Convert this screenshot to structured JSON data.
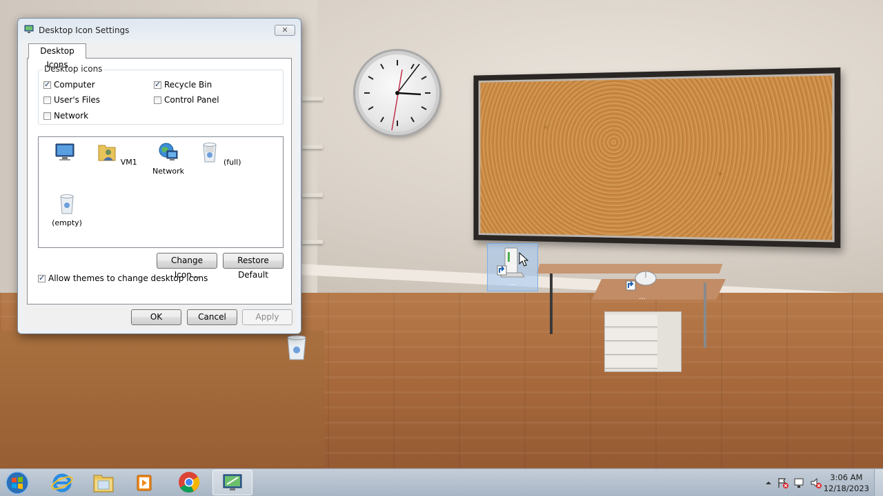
{
  "dialog": {
    "title": "Desktop Icon Settings",
    "close_glyph": "✕",
    "tab_label": "Desktop Icons",
    "group_label": "Desktop icons",
    "checkboxes": [
      {
        "label": "Computer",
        "checked": true
      },
      {
        "label": "Recycle Bin",
        "checked": true
      },
      {
        "label": "User's Files",
        "checked": false
      },
      {
        "label": "Control Panel",
        "checked": false
      },
      {
        "label": "Network",
        "checked": false
      }
    ],
    "icon_list": [
      {
        "label": "",
        "icon": "computer-icon"
      },
      {
        "label": "VM1",
        "icon": "user-folder-icon"
      },
      {
        "label": "Network",
        "icon": "network-icon"
      },
      {
        "label": "(full)",
        "icon": "recycle-bin-full-icon"
      },
      {
        "label": "(empty)",
        "icon": "recycle-bin-empty-icon"
      }
    ],
    "change_icon_label": "Change Icon...",
    "restore_default_label": "Restore Default",
    "allow_themes_label": "Allow themes to change desktop icons",
    "allow_themes_checked": true,
    "ok_label": "OK",
    "cancel_label": "Cancel",
    "apply_label": "Apply"
  },
  "desktop": {
    "icons": [
      {
        "label": "",
        "icon": "recycle-bin-icon"
      },
      {
        "label": "...",
        "icon": "drive-shortcut-icon",
        "selected": true
      },
      {
        "label": "...",
        "icon": "mouse-shortcut-icon"
      }
    ]
  },
  "taskbar": {
    "pinned": [
      {
        "icon": "internet-explorer-icon"
      },
      {
        "icon": "file-explorer-icon"
      },
      {
        "icon": "media-player-icon"
      },
      {
        "icon": "chrome-icon"
      },
      {
        "icon": "desktop-icon-settings-icon",
        "active": true
      }
    ],
    "time": "3:06 AM",
    "date": "12/18/2023",
    "tray_icons": [
      "show-hidden-icons-arrow",
      "action-center-flag-icon",
      "network-icon",
      "volume-muted-icon"
    ]
  },
  "colors": {
    "accent": "#3a7fd0",
    "taskbar": "#b4c6d9"
  }
}
